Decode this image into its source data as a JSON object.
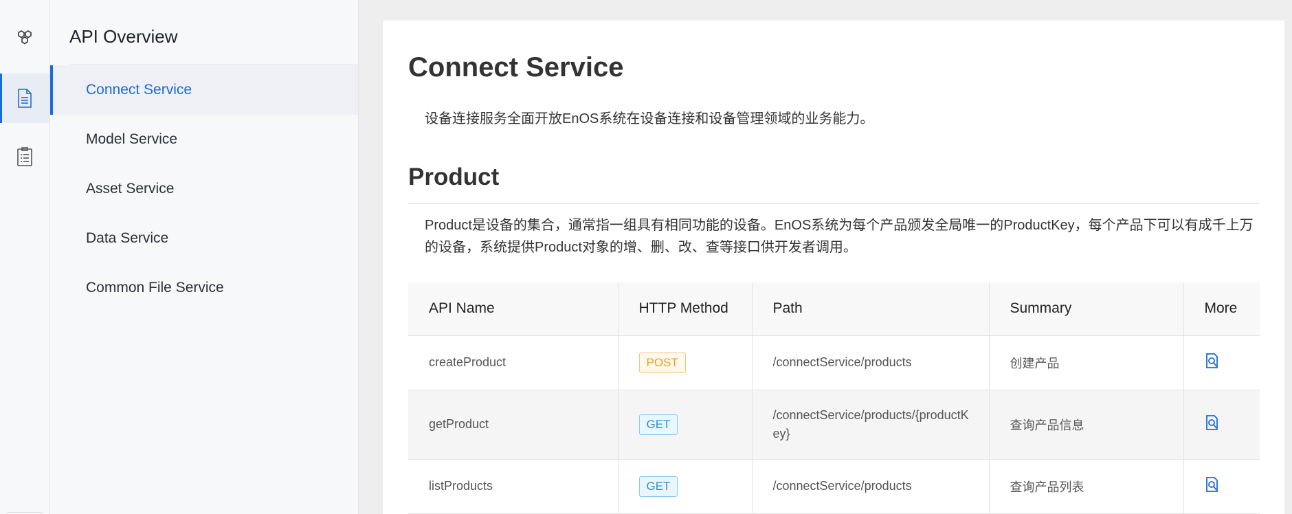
{
  "rail": {
    "items": [
      {
        "icon": "hexagons-icon",
        "active": false
      },
      {
        "icon": "document-icon",
        "active": true
      },
      {
        "icon": "checklist-icon",
        "active": false
      }
    ]
  },
  "sidebar": {
    "title": "API Overview",
    "items": [
      {
        "label": "Connect Service",
        "active": true
      },
      {
        "label": "Model Service",
        "active": false
      },
      {
        "label": "Asset Service",
        "active": false
      },
      {
        "label": "Data Service",
        "active": false
      },
      {
        "label": "Common File Service",
        "active": false
      }
    ]
  },
  "main": {
    "title": "Connect Service",
    "description": "设备连接服务全面开放EnOS系统在设备连接和设备管理领域的业务能力。",
    "section": {
      "title": "Product",
      "description": "Product是设备的集合，通常指一组具有相同功能的设备。EnOS系统为每个产品颁发全局唯一的ProductKey，每个产品下可以有成千上万的设备，系统提供Product对象的增、删、改、查等接口供开发者调用。"
    },
    "table": {
      "headers": [
        "API Name",
        "HTTP Method",
        "Path",
        "Summary",
        "More"
      ],
      "rows": [
        {
          "name": "createProduct",
          "method": "POST",
          "path": "/connectService/products",
          "summary": "创建产品"
        },
        {
          "name": "getProduct",
          "method": "GET",
          "path": "/connectService/products/{productKey}",
          "summary": "查询产品信息"
        },
        {
          "name": "listProducts",
          "method": "GET",
          "path": "/connectService/products",
          "summary": "查询产品列表"
        }
      ]
    }
  },
  "colors": {
    "accent": "#1a6cdb",
    "post": "#f0a020",
    "get": "#2a90d0"
  }
}
